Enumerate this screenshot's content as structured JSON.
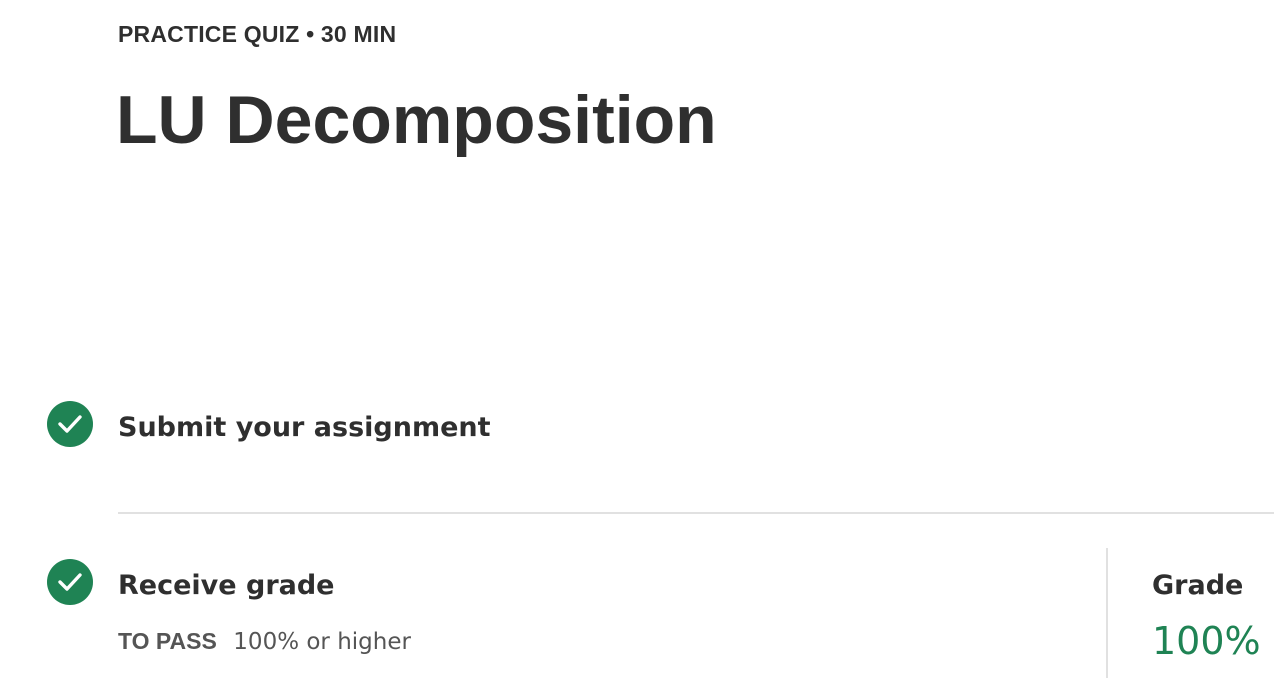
{
  "header": {
    "eyebrow": "PRACTICE QUIZ • 30 MIN",
    "title": "LU Decomposition"
  },
  "steps": [
    {
      "label": "Submit your assignment",
      "icon": "checkmark-circle-icon",
      "status": "complete"
    },
    {
      "label": "Receive grade",
      "icon": "checkmark-circle-icon",
      "status": "complete",
      "pass_label": "TO PASS",
      "pass_value": "100% or higher"
    }
  ],
  "grade": {
    "label": "Grade",
    "value": "100%"
  },
  "colors": {
    "success": "#1f8354",
    "text": "#2f2f2f",
    "muted": "#555555",
    "divider": "#e1e1e1"
  }
}
